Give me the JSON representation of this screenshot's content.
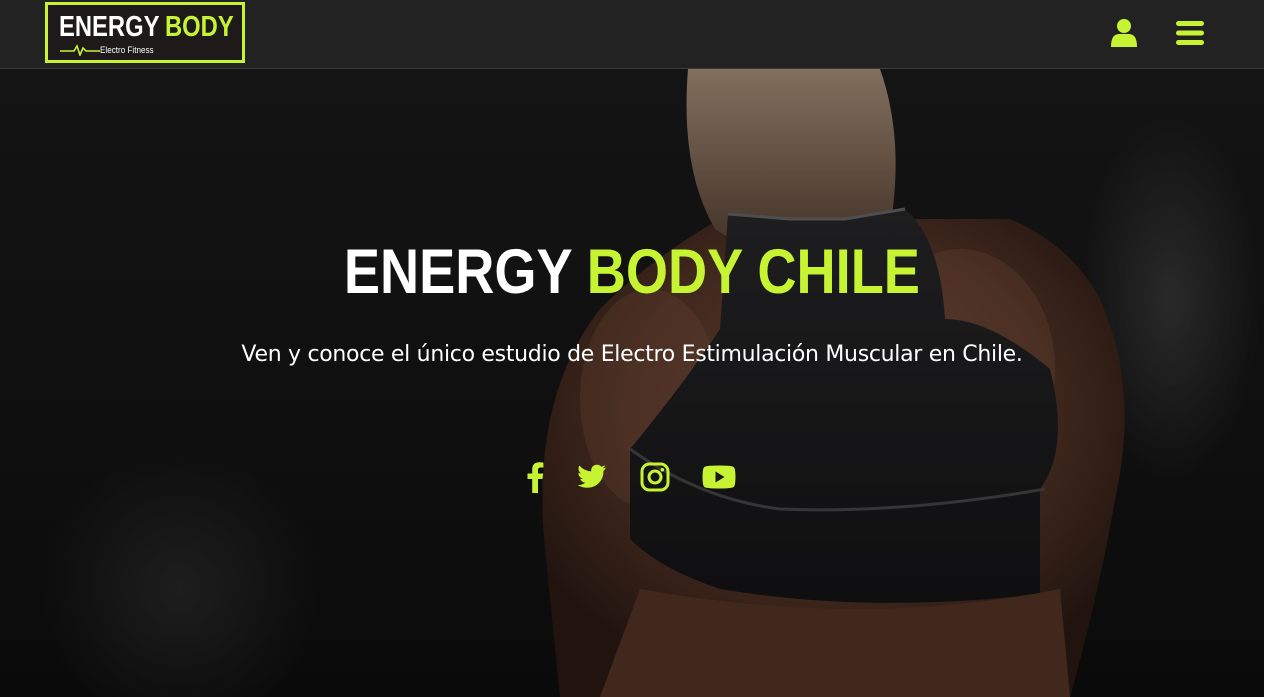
{
  "header": {
    "logo": {
      "word1": "ENERGY",
      "word2": "BODY",
      "tagline": "Electro Fitness"
    },
    "user_icon": "user-icon",
    "menu_icon": "hamburger-menu-icon"
  },
  "hero": {
    "title_part1": "ENERGY ",
    "title_part2": "BODY CHILE",
    "subtitle": "Ven y conoce el único estudio de Electro Estimulación Muscular en Chile.",
    "social": [
      {
        "name": "facebook",
        "icon": "facebook-icon"
      },
      {
        "name": "twitter",
        "icon": "twitter-icon"
      },
      {
        "name": "instagram",
        "icon": "instagram-icon"
      },
      {
        "name": "youtube",
        "icon": "youtube-icon"
      }
    ]
  },
  "colors": {
    "accent": "#c6f432",
    "header_bg": "#222222",
    "text": "#ffffff"
  }
}
